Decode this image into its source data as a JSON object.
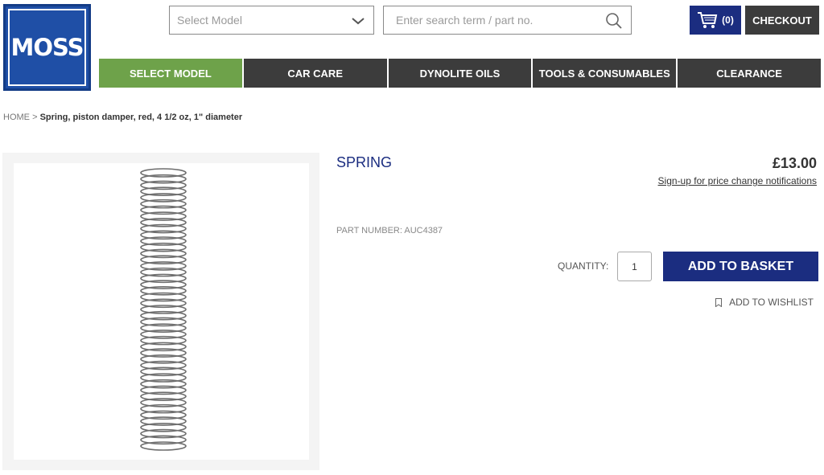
{
  "brand": {
    "logo_text": "MOSS",
    "color": "#1f4fa6"
  },
  "header": {
    "select_placeholder": "Select Model",
    "search_placeholder": "Enter search term / part no.",
    "cart_count": "(0)",
    "checkout_label": "CHECKOUT"
  },
  "nav": {
    "items": [
      {
        "label": "SELECT MODEL",
        "active": true
      },
      {
        "label": "CAR CARE"
      },
      {
        "label": "DYNOLITE OILS"
      },
      {
        "label": "TOOLS & CONSUMABLES"
      },
      {
        "label": "CLEARANCE"
      }
    ]
  },
  "breadcrumb": {
    "home": "HOME",
    "separator": ">",
    "current": "Spring, piston damper, red, 4 1/2 oz, 1\" diameter"
  },
  "product": {
    "title": "SPRING",
    "price": "£13.00",
    "price_notify": "Sign-up for price change notifications",
    "part_number": "PART NUMBER: AUC4387",
    "quantity_label": "QUANTITY:",
    "quantity": "1",
    "add_to_basket": "ADD TO BASKET",
    "add_to_wishlist": "ADD TO WISHLIST"
  },
  "icons": [
    "chevron-down-icon",
    "search-icon",
    "cart-icon",
    "bookmark-icon"
  ],
  "colors": {
    "navy": "#1b2d80",
    "green": "#6ea24a",
    "dark": "#3c3c3c"
  }
}
